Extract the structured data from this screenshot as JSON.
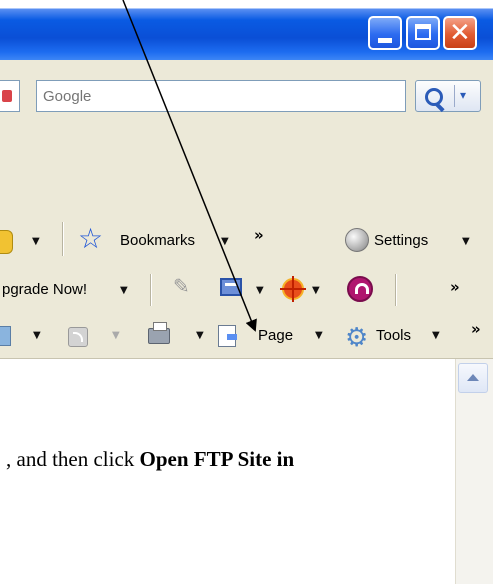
{
  "window": {
    "controls": {
      "minimize": "minimize",
      "maximize": "maximize",
      "close": "close"
    }
  },
  "search": {
    "placeholder": "Google"
  },
  "toolbar_row1": {
    "bookmarks_label": "Bookmarks",
    "overflow": "»",
    "settings_label": "Settings"
  },
  "toolbar_row2": {
    "upgrade_label": "pgrade Now!",
    "overflow": "»"
  },
  "toolbar_row3": {
    "page_label": "Page",
    "tools_label": "Tools",
    "overflow": "»"
  },
  "content": {
    "lead_text": ", and then click ",
    "bold_text": "Open FTP Site in"
  },
  "annotation": {
    "arrow_target": "Page menu"
  },
  "icons": [
    "minimize-icon",
    "maximize-icon",
    "close-icon",
    "search-icon",
    "star-icon",
    "settings-icon",
    "pencil-icon",
    "screen-icon",
    "target-icon",
    "headphone-icon",
    "home-icon",
    "feed-icon",
    "printer-icon",
    "page-icon",
    "gear-icon"
  ]
}
